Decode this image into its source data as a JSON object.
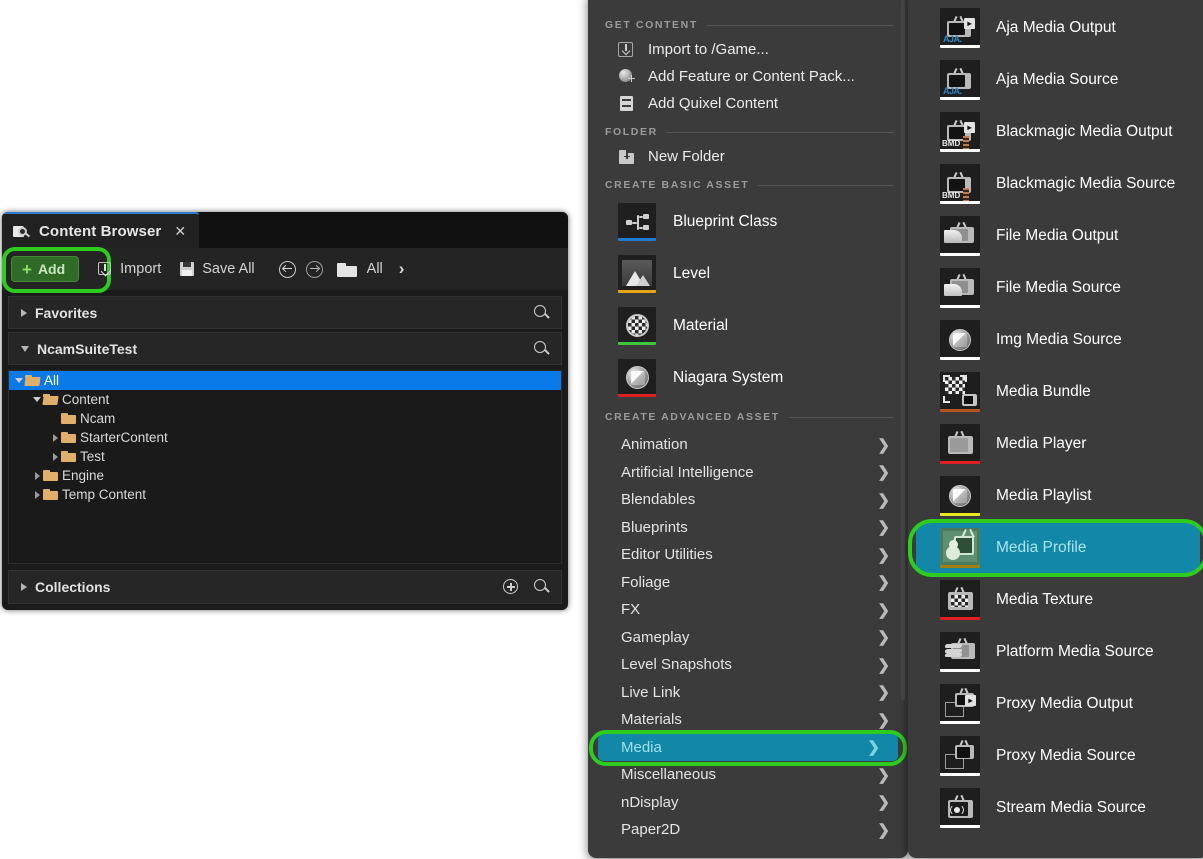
{
  "content_browser": {
    "tab_title": "Content Browser",
    "tab_close": "✕",
    "tab_icon": "content-browser-icon",
    "toolbar": {
      "add_label": "Add",
      "add_plus": "+",
      "import_label": "Import",
      "save_all_label": "Save All",
      "back_icon": "back-arrow-icon",
      "forward_icon": "forward-arrow-icon",
      "path_folder_icon": "folder-icon",
      "path_label": "All",
      "path_chevron": "›"
    },
    "sections": [
      {
        "label": "Favorites",
        "expanded": false
      },
      {
        "label": "NcamSuiteTest",
        "expanded": true
      }
    ],
    "tree": [
      {
        "label": "All",
        "depth": 0,
        "arrow": "down",
        "selected": true,
        "folder": "open"
      },
      {
        "label": "Content",
        "depth": 1,
        "arrow": "down",
        "selected": false,
        "folder": "open"
      },
      {
        "label": "Ncam",
        "depth": 2,
        "arrow": "none",
        "selected": false,
        "folder": "closed"
      },
      {
        "label": "StarterContent",
        "depth": 2,
        "arrow": "right",
        "selected": false,
        "folder": "closed"
      },
      {
        "label": "Test",
        "depth": 2,
        "arrow": "right",
        "selected": false,
        "folder": "closed"
      },
      {
        "label": "Engine",
        "depth": 1,
        "arrow": "right",
        "selected": false,
        "folder": "closed"
      },
      {
        "label": "Temp Content",
        "depth": 1,
        "arrow": "right",
        "selected": false,
        "folder": "closed"
      }
    ],
    "collections": {
      "label": "Collections",
      "add_icon": "add-collection-icon",
      "search_icon": "search-icon"
    }
  },
  "add_menu": {
    "headers": {
      "get_content": "GET CONTENT",
      "folder": "FOLDER",
      "create_basic_asset": "CREATE BASIC ASSET",
      "create_advanced_asset": "CREATE ADVANCED ASSET"
    },
    "get_content_items": [
      {
        "label": "Import to /Game...",
        "icon": "import-icon"
      },
      {
        "label": "Add Feature or Content Pack...",
        "icon": "content-pack-icon"
      },
      {
        "label": "Add Quixel Content",
        "icon": "quixel-icon"
      }
    ],
    "folder_items": [
      {
        "label": "New Folder",
        "icon": "new-folder-icon"
      }
    ],
    "basic_assets": [
      {
        "label": "Blueprint Class",
        "icon": "blueprint-class-icon",
        "bar_color": "#1f7ad4"
      },
      {
        "label": "Level",
        "icon": "level-icon",
        "bar_color": "#e8a317"
      },
      {
        "label": "Material",
        "icon": "material-icon",
        "bar_color": "#3bc93b"
      },
      {
        "label": "Niagara System",
        "icon": "niagara-system-icon",
        "bar_color": "#e02020"
      }
    ],
    "advanced_assets": [
      {
        "label": "Animation",
        "active": false
      },
      {
        "label": "Artificial Intelligence",
        "active": false
      },
      {
        "label": "Blendables",
        "active": false
      },
      {
        "label": "Blueprints",
        "active": false
      },
      {
        "label": "Editor Utilities",
        "active": false
      },
      {
        "label": "Foliage",
        "active": false
      },
      {
        "label": "FX",
        "active": false
      },
      {
        "label": "Gameplay",
        "active": false
      },
      {
        "label": "Level Snapshots",
        "active": false
      },
      {
        "label": "Live Link",
        "active": false
      },
      {
        "label": "Materials",
        "active": false
      },
      {
        "label": "Media",
        "active": true
      },
      {
        "label": "Miscellaneous",
        "active": false
      },
      {
        "label": "nDisplay",
        "active": false
      },
      {
        "label": "Paper2D",
        "active": false
      }
    ],
    "submenu_chevron": "❯"
  },
  "media_menu": {
    "items": [
      {
        "label": "Aja Media Output",
        "icon": "aja-media-output-icon",
        "bar_color": "#ffffff",
        "active": false
      },
      {
        "label": "Aja Media Source",
        "icon": "aja-media-source-icon",
        "bar_color": "#ffffff",
        "active": false
      },
      {
        "label": "Blackmagic Media Output",
        "icon": "blackmagic-media-output-icon",
        "bar_color": "#ffffff",
        "active": false
      },
      {
        "label": "Blackmagic Media Source",
        "icon": "blackmagic-media-source-icon",
        "bar_color": "#ffffff",
        "active": false
      },
      {
        "label": "File Media Output",
        "icon": "file-media-output-icon",
        "bar_color": "#ffffff",
        "active": false
      },
      {
        "label": "File Media Source",
        "icon": "file-media-source-icon",
        "bar_color": "#ffffff",
        "active": false
      },
      {
        "label": "Img Media Source",
        "icon": "img-media-source-icon",
        "bar_color": "#ffffff",
        "active": false
      },
      {
        "label": "Media Bundle",
        "icon": "media-bundle-icon",
        "bar_color": "#b4531f",
        "active": false
      },
      {
        "label": "Media Player",
        "icon": "media-player-icon",
        "bar_color": "#e02020",
        "active": false
      },
      {
        "label": "Media Playlist",
        "icon": "media-playlist-icon",
        "bar_color": "#e8e820",
        "active": false
      },
      {
        "label": "Media Profile",
        "icon": "media-profile-icon",
        "bar_color": "#a08010",
        "active": true
      },
      {
        "label": "Media Texture",
        "icon": "media-texture-icon",
        "bar_color": "#e02020",
        "active": false
      },
      {
        "label": "Platform Media Source",
        "icon": "platform-media-source-icon",
        "bar_color": "#ffffff",
        "active": false
      },
      {
        "label": "Proxy Media Output",
        "icon": "proxy-media-output-icon",
        "bar_color": "#ffffff",
        "active": false
      },
      {
        "label": "Proxy Media Source",
        "icon": "proxy-media-source-icon",
        "bar_color": "#ffffff",
        "active": false
      },
      {
        "label": "Stream Media Source",
        "icon": "stream-media-source-icon",
        "bar_color": "#ffffff",
        "active": false
      }
    ]
  },
  "annotations": {
    "highlight_color": "#2ecc1f",
    "selection_color": "#1287a8",
    "tree_selection_color": "#0a7ae8",
    "targets": [
      "Add",
      "Media",
      "Media Profile"
    ]
  }
}
